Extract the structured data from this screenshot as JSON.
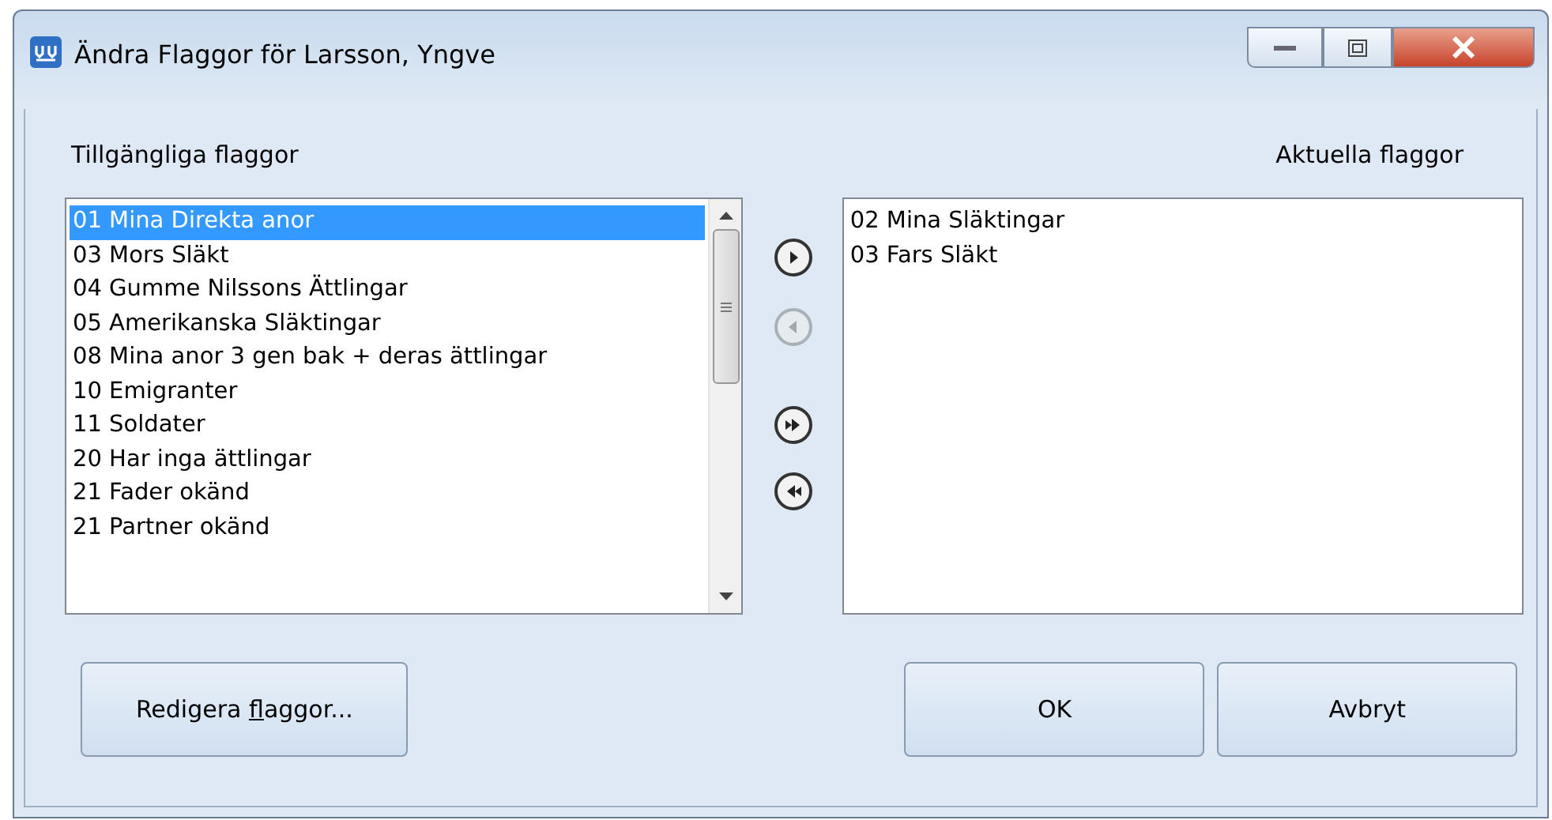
{
  "window": {
    "title": "Ändra Flaggor för Larsson, Yngve"
  },
  "available": {
    "heading": "Tillgängliga flaggor",
    "items": [
      {
        "label": "01 Mina Direkta anor",
        "selected": true
      },
      {
        "label": "03 Mors Släkt",
        "selected": false
      },
      {
        "label": "04 Gumme Nilssons Ättlingar",
        "selected": false
      },
      {
        "label": "05 Amerikanska Släktingar",
        "selected": false
      },
      {
        "label": "08 Mina anor 3 gen bak + deras ättlingar",
        "selected": false
      },
      {
        "label": "10 Emigranter",
        "selected": false
      },
      {
        "label": "11 Soldater",
        "selected": false
      },
      {
        "label": "20 Har inga ättlingar",
        "selected": false
      },
      {
        "label": "21 Fader okänd",
        "selected": false
      },
      {
        "label": "21 Partner okänd",
        "selected": false
      }
    ]
  },
  "move_buttons": [
    {
      "kind": "add",
      "disabled": false
    },
    {
      "kind": "remove",
      "disabled": true
    },
    {
      "kind": "add-all",
      "disabled": false
    },
    {
      "kind": "remove-all",
      "disabled": false
    }
  ],
  "current": {
    "heading": "Aktuella flaggor",
    "items": [
      {
        "label": "02 Mina Släktingar",
        "selected": false
      },
      {
        "label": "03 Fars Släkt",
        "selected": false
      }
    ]
  },
  "edit_button": {
    "label_before": "Redigera ",
    "access_key": "f",
    "label_after": "laggor..."
  },
  "buttons": [
    "OK",
    "Avbryt"
  ]
}
